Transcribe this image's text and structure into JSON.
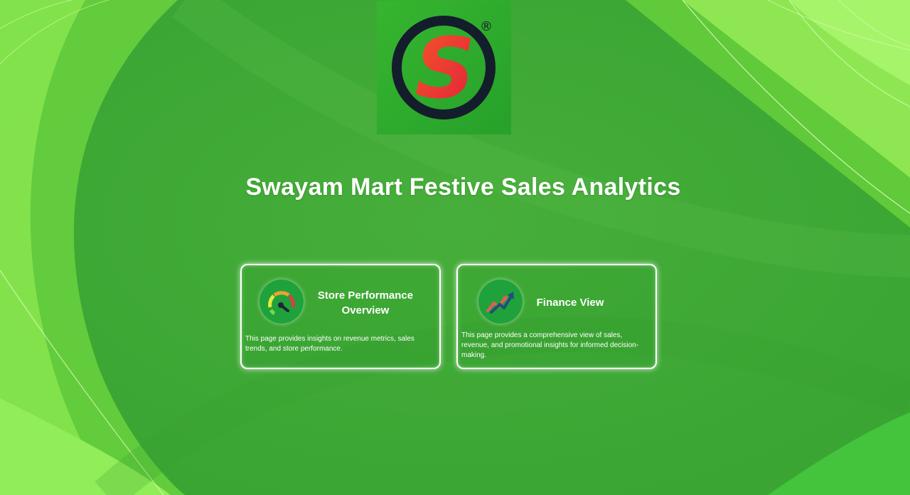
{
  "header": {
    "title": "Swayam Mart Festive Sales Analytics"
  },
  "logo": {
    "letter": "S",
    "registered_mark": "®"
  },
  "nav_cards": [
    {
      "title": "Store Performance Overview",
      "description": "This page provides insights on revenue metrics, sales trends, and store performance.",
      "icon": "gauge-icon"
    },
    {
      "title": "Finance View",
      "description": "This page provides a comprehensive view of sales, revenue, and promotional insights for informed decision-making.",
      "icon": "trend-arrow-icon"
    }
  ],
  "colors": {
    "background": "#3fa836",
    "light_green": "#8de84f",
    "logo_red": "#e8302e",
    "logo_orange": "#f4562a",
    "logo_ring": "#141d2b",
    "card_border": "#ffffff",
    "text": "#ffffff"
  }
}
